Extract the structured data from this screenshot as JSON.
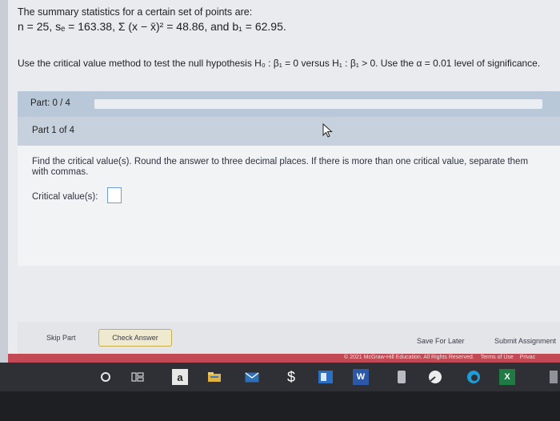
{
  "problem": {
    "intro": "The summary statistics for a certain set of points are:",
    "stats_line": "n = 25, sₑ = 163.38, Σ (x − x̄)² = 48.86, and b₁ = 62.95.",
    "instruction": "Use the critical value method to test the null hypothesis H₀ : β₁ = 0 versus H₁ : β₁ > 0. Use the α = 0.01 level of significance."
  },
  "progress": {
    "label": "Part: 0 / 4",
    "fraction": 0.0
  },
  "part": {
    "label": "Part 1 of 4"
  },
  "question": {
    "text": "Find the critical value(s). Round the answer to three decimal places. If there is more than one critical value, separate them with commas.",
    "answer_label": "Critical value(s):",
    "answer_value": ""
  },
  "footer": {
    "skip": "Skip Part",
    "check": "Check Answer",
    "save": "Save For Later",
    "submit": "Submit Assignment"
  },
  "copyright": {
    "text": "© 2021 McGraw-Hill Education. All Rights Reserved.",
    "terms": "Terms of Use",
    "privacy": "Privac"
  },
  "taskbar": {
    "icons": [
      "search-circle-icon",
      "task-view-icon",
      "amazon-icon",
      "file-explorer-icon",
      "mail-icon",
      "money-icon",
      "outlook-icon",
      "word-icon",
      "app-icon",
      "chrome-icon",
      "edge-icon",
      "excel-icon"
    ],
    "amazon_letter": "a",
    "word_letter": "W",
    "excel_letter": "X"
  },
  "colors": {
    "accent": "#6da0d8",
    "red_bar": "#c24a55",
    "check_border": "#c8ad4a"
  }
}
